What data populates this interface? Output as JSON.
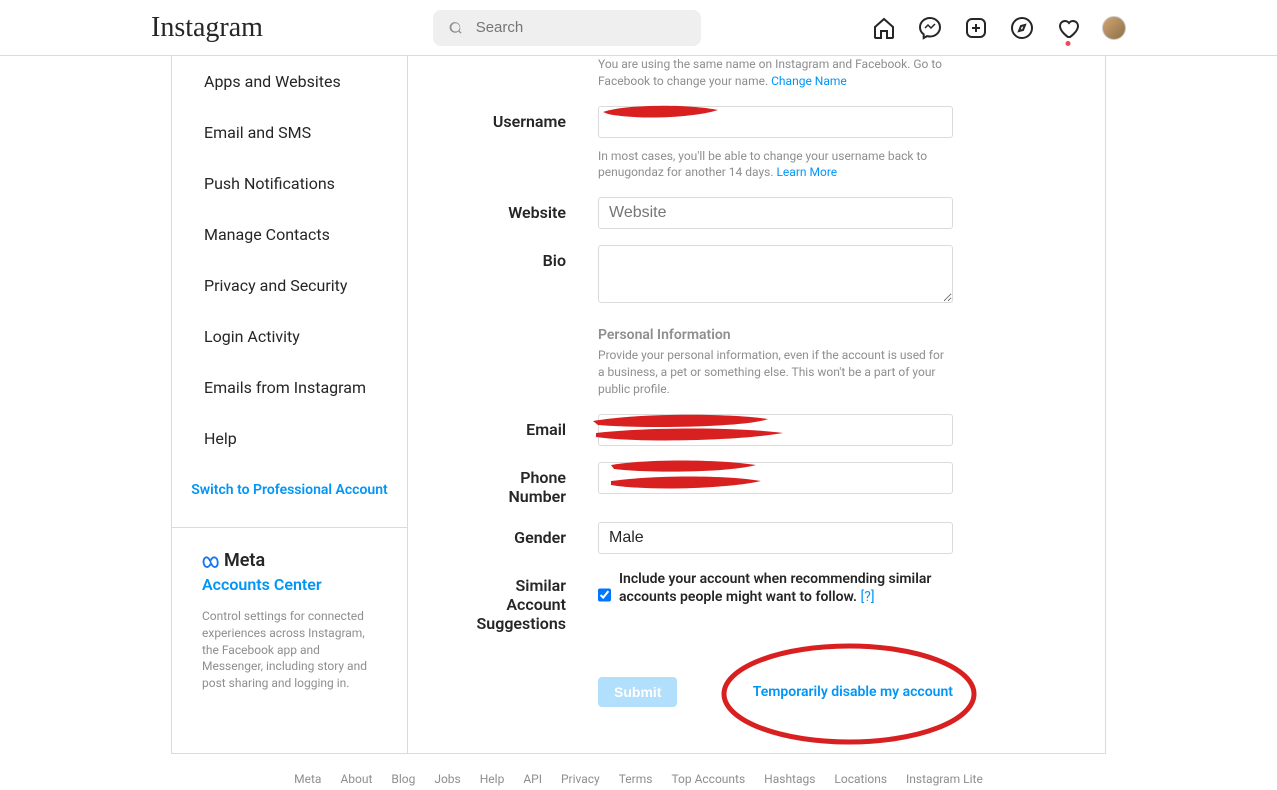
{
  "header": {
    "logo": "Instagram",
    "search_placeholder": "Search"
  },
  "sidebar": {
    "items": [
      "Apps and Websites",
      "Email and SMS",
      "Push Notifications",
      "Manage Contacts",
      "Privacy and Security",
      "Login Activity",
      "Emails from Instagram",
      "Help"
    ],
    "switch_pro": "Switch to Professional Account"
  },
  "meta_box": {
    "brand": "Meta",
    "accounts_center": "Accounts Center",
    "desc": "Control settings for connected experiences across Instagram, the Facebook app and Messenger, including story and post sharing and logging in."
  },
  "form": {
    "name_helper": "You are using the same name on Instagram and Facebook. Go to Facebook to change your name.",
    "change_name": "Change Name",
    "username_label": "Username",
    "username_value": "",
    "username_helper": "In most cases, you'll be able to change your username back to penugondaz for another 14 days.",
    "learn_more": "Learn More",
    "website_label": "Website",
    "website_placeholder": "Website",
    "bio_label": "Bio",
    "personal_info_header": "Personal Information",
    "personal_info_desc": "Provide your personal information, even if the account is used for a business, a pet or something else. This won't be a part of your public profile.",
    "email_label": "Email",
    "email_value": "",
    "phone_label": "Phone Number",
    "phone_value": "",
    "gender_label": "Gender",
    "gender_value": "Male",
    "similar_label_1": "Similar Account",
    "similar_label_2": "Suggestions",
    "similar_checkbox_label": "Include your account when recommending similar accounts people might want to follow.",
    "similar_help": "[?]",
    "submit": "Submit",
    "disable": "Temporarily disable my account"
  },
  "footer": {
    "items": [
      "Meta",
      "About",
      "Blog",
      "Jobs",
      "Help",
      "API",
      "Privacy",
      "Terms",
      "Top Accounts",
      "Hashtags",
      "Locations",
      "Instagram Lite"
    ]
  }
}
